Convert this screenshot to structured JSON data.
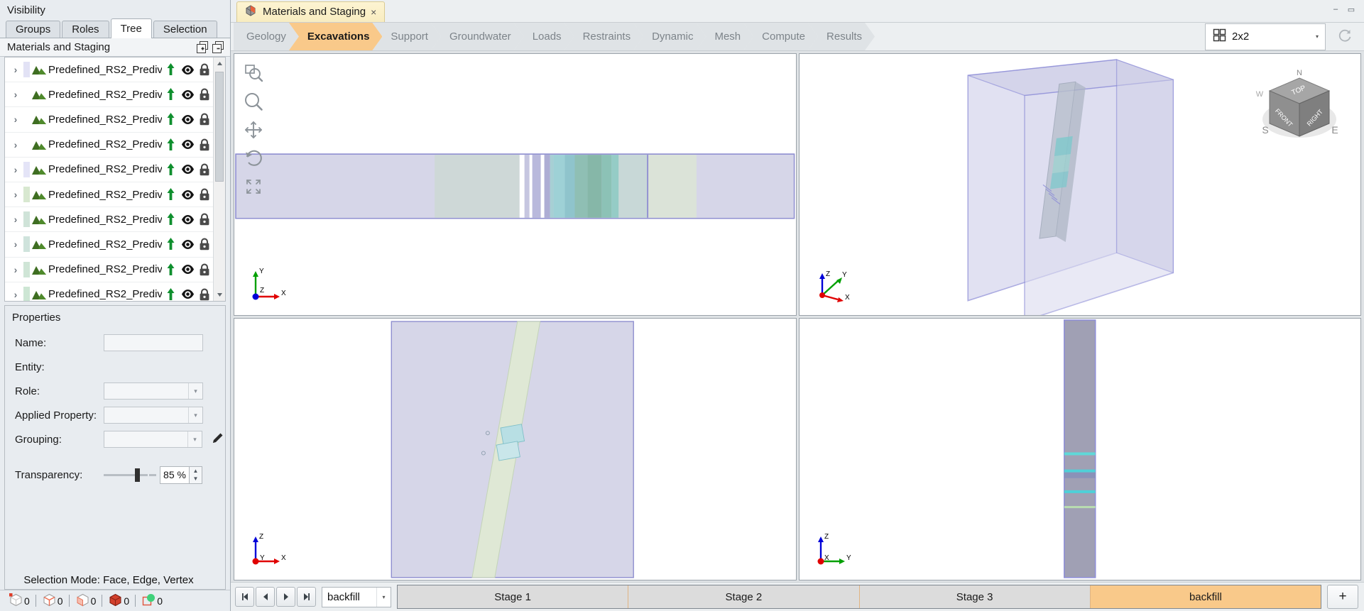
{
  "left_panel": {
    "title": "Visibility",
    "tabs": [
      {
        "label": "Groups",
        "active": false
      },
      {
        "label": "Roles",
        "active": false
      },
      {
        "label": "Tree",
        "active": true
      },
      {
        "label": "Selection",
        "active": false
      }
    ],
    "tree_header": {
      "label": "Materials and Staging",
      "expand_all_icon": "expand-all-icon",
      "collapse_all_icon": "collapse-all-icon"
    },
    "tree_items": [
      {
        "label": "Predefined_RS2_Predivid",
        "swatch": "#e2e2f5"
      },
      {
        "label": "Predefined_RS2_Predivid",
        "swatch": "#ffffff"
      },
      {
        "label": "Predefined_RS2_Predivid",
        "swatch": "#ffffff"
      },
      {
        "label": "Predefined_RS2_Predivid",
        "swatch": "#ffffff"
      },
      {
        "label": "Predefined_RS2_Predivid",
        "swatch": "#e4e4f7"
      },
      {
        "label": "Predefined_RS2_Predivid",
        "swatch": "#d8e8d0"
      },
      {
        "label": "Predefined_RS2_Predivid",
        "swatch": "#cfe3d8"
      },
      {
        "label": "Predefined_RS2_Predivid",
        "swatch": "#cfe3dc"
      },
      {
        "label": "Predefined_RS2_Predivid",
        "swatch": "#cfe5d6"
      },
      {
        "label": "Predefined_RS2_Predivid",
        "swatch": "#cde6d4"
      }
    ],
    "row_icons": {
      "visibility_up": "arrow-up-icon",
      "eye": "eye-icon",
      "lock": "lock-icon"
    },
    "properties": {
      "title": "Properties",
      "fields": [
        {
          "label": "Name:",
          "type": "text",
          "value": ""
        },
        {
          "label": "Entity:",
          "type": "static",
          "value": ""
        },
        {
          "label": "Role:",
          "type": "combo",
          "value": ""
        },
        {
          "label": "Applied Property:",
          "type": "combo",
          "value": ""
        },
        {
          "label": "Grouping:",
          "type": "combo",
          "value": ""
        }
      ],
      "transparency": {
        "label": "Transparency:",
        "value": "85 %",
        "percent": 85
      },
      "edit_icon": "pencil-icon"
    },
    "selection_mode": {
      "prefix": "Selection Mode:",
      "value": "Face, Edge, Vertex"
    },
    "status_counts": [
      {
        "icon": "vertex-count-icon",
        "value": "0"
      },
      {
        "icon": "edge-count-icon",
        "value": "0"
      },
      {
        "icon": "face-count-icon",
        "value": "0"
      },
      {
        "icon": "solid-count-icon",
        "value": "0"
      },
      {
        "icon": "group-count-icon",
        "value": "0"
      }
    ]
  },
  "document_tabs": [
    {
      "label": "Materials and Staging",
      "icon": "model-icon",
      "close": "×",
      "active": true
    }
  ],
  "window_controls": [
    {
      "name": "minimize-button",
      "glyph": "–"
    },
    {
      "name": "restore-button",
      "glyph": "▭"
    }
  ],
  "workflow_tabs": [
    {
      "label": "Geology",
      "active": false
    },
    {
      "label": "Excavations",
      "active": true
    },
    {
      "label": "Support",
      "active": false
    },
    {
      "label": "Groundwater",
      "active": false
    },
    {
      "label": "Loads",
      "active": false
    },
    {
      "label": "Restraints",
      "active": false
    },
    {
      "label": "Dynamic",
      "active": false
    },
    {
      "label": "Mesh",
      "active": false
    },
    {
      "label": "Compute",
      "active": false
    },
    {
      "label": "Results",
      "active": false
    }
  ],
  "layout_selector": {
    "value": "2x2",
    "icon": "grid-2x2-icon",
    "arrow": "▾"
  },
  "refresh_button": {
    "icon": "refresh-icon"
  },
  "viewport_toolbar": [
    {
      "icon": "zoom-window-icon",
      "tooltip": "Zoom Window"
    },
    {
      "icon": "zoom-icon",
      "tooltip": "Zoom"
    },
    {
      "icon": "pan-icon",
      "tooltip": "Pan"
    },
    {
      "icon": "rotate-icon",
      "tooltip": "Rotate"
    },
    {
      "icon": "zoom-all-icon",
      "tooltip": "Zoom All"
    }
  ],
  "viewports": [
    {
      "name": "viewport-front",
      "axes": {
        "up": "Y",
        "right": "X",
        "origin": "Z"
      }
    },
    {
      "name": "viewport-iso",
      "axes": {
        "up": "Z",
        "right": "X",
        "other": "Y"
      }
    },
    {
      "name": "viewport-side",
      "axes": {
        "up": "Z",
        "right": "X",
        "origin": "Y"
      }
    },
    {
      "name": "viewport-top",
      "axes": {
        "up": "Z",
        "right": "Y",
        "origin": "X"
      }
    }
  ],
  "view_cube": {
    "faces": [
      "TOP",
      "FRONT",
      "RIGHT"
    ],
    "compass": [
      "N",
      "S",
      "E",
      "W"
    ]
  },
  "stage_bar": {
    "nav_buttons": [
      {
        "name": "first-stage-button",
        "glyph": "first"
      },
      {
        "name": "prev-stage-button",
        "glyph": "prev"
      },
      {
        "name": "next-stage-button",
        "glyph": "next"
      },
      {
        "name": "last-stage-button",
        "glyph": "last"
      }
    ],
    "stage_selector": {
      "value": "backfill",
      "arrow": "▾"
    },
    "stages": [
      {
        "label": "Stage 1",
        "active": false
      },
      {
        "label": "Stage 2",
        "active": false
      },
      {
        "label": "Stage 3",
        "active": false
      },
      {
        "label": "backfill",
        "active": true
      }
    ],
    "add_stage_label": "+"
  },
  "colors": {
    "accent": "#f9c98a",
    "tab_yellow": "#f8ecc0",
    "panel_bg": "#e8ecf0",
    "model_purple": "#d6d6e8",
    "model_teal": "#9fd4d4",
    "model_green": "#d8e8cc"
  }
}
